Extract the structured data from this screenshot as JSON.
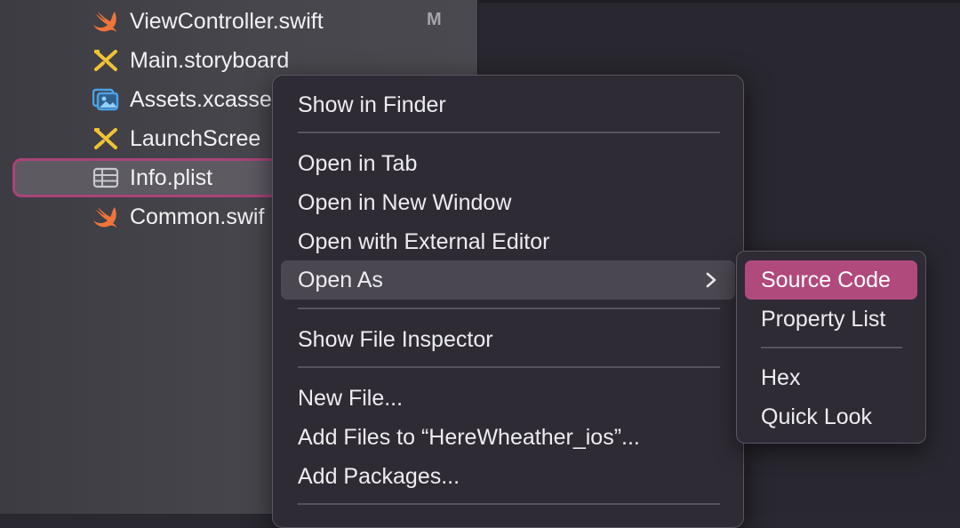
{
  "navigator": {
    "files": [
      {
        "name": "ViewController.swift",
        "icon": "swift-file-icon",
        "badge": "M"
      },
      {
        "name": "Main.storyboard",
        "icon": "storyboard-file-icon"
      },
      {
        "name": "Assets.xcasse",
        "icon": "asset-catalog-icon"
      },
      {
        "name": "LaunchScree",
        "icon": "storyboard-file-icon"
      },
      {
        "name": "Info.plist",
        "icon": "plist-file-icon",
        "selected": true
      },
      {
        "name": "Common.swif",
        "icon": "swift-file-icon"
      }
    ]
  },
  "context_menu": {
    "show_in_finder": "Show in Finder",
    "open_in_tab": "Open in Tab",
    "open_in_new_window": "Open in New Window",
    "open_with_external_editor": "Open with External Editor",
    "open_as": "Open As",
    "show_file_inspector": "Show File Inspector",
    "new_file": "New File...",
    "add_files": "Add Files to “HereWheather_ios”...",
    "add_packages": "Add Packages..."
  },
  "open_as_submenu": {
    "source_code": "Source Code",
    "property_list": "Property List",
    "hex": "Hex",
    "quick_look": "Quick Look"
  },
  "colors": {
    "selection_border": "#a84477",
    "submenu_highlight": "#b04a7c",
    "swift_orange": "#f0743a",
    "storyboard_yellow": "#f1c232",
    "asset_blue": "#4aa3e8"
  }
}
